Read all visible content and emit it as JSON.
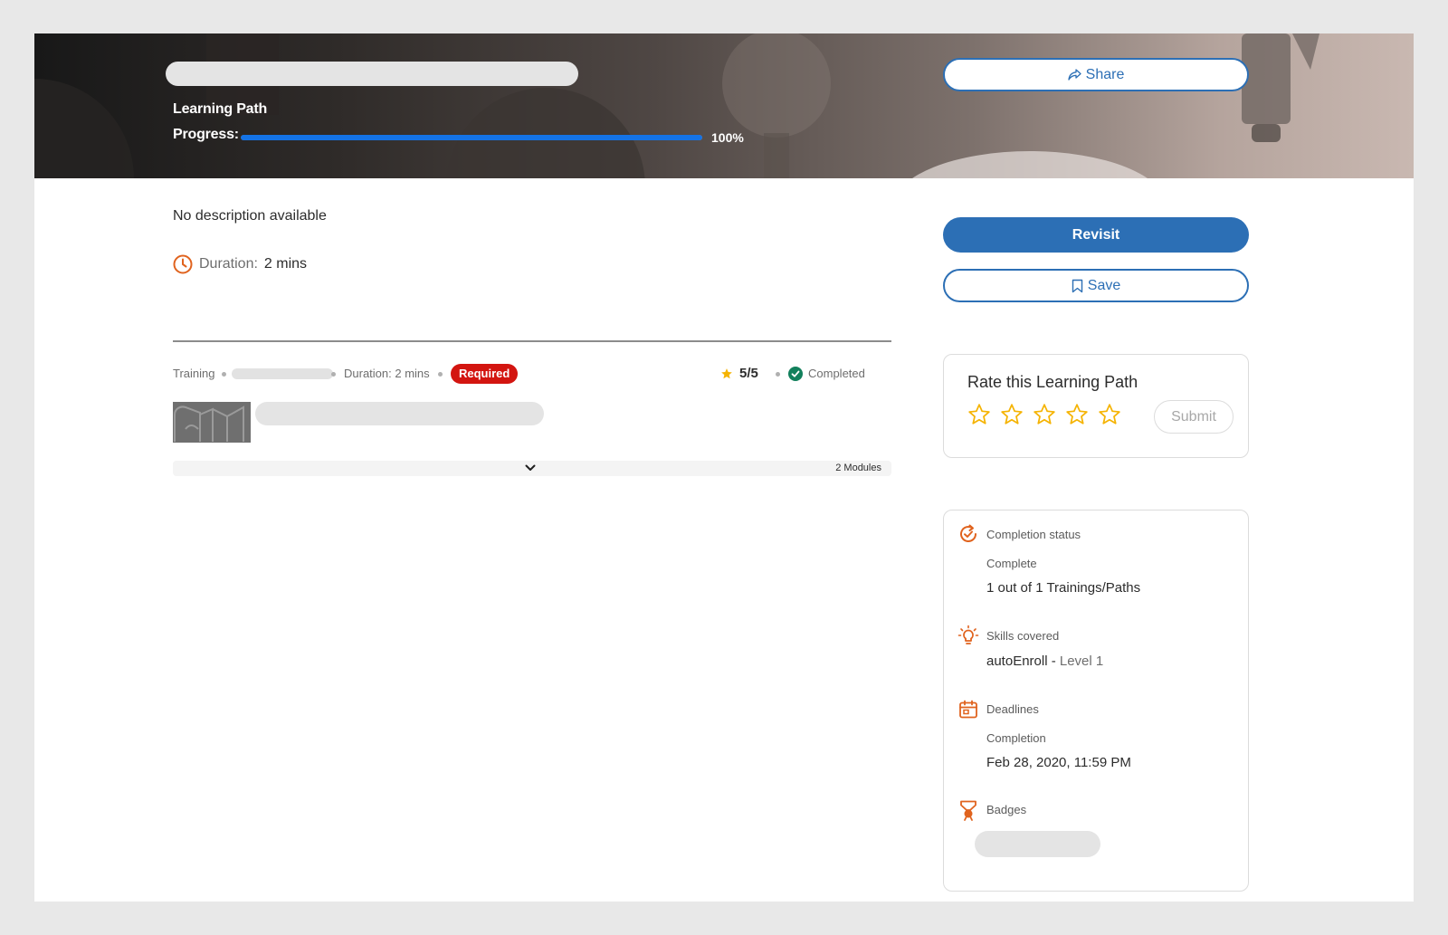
{
  "header": {
    "type_label": "Learning Path",
    "progress_label": "Progress:",
    "progress_value": "100%",
    "progress_fraction": 1.0,
    "share_label": "Share"
  },
  "overview": {
    "description": "No description available",
    "duration_label": "Duration:",
    "duration_value": "2 mins"
  },
  "actions": {
    "revisit_label": "Revisit",
    "save_label": "Save"
  },
  "course_item": {
    "type": "Training",
    "duration": "Duration: 2 mins",
    "required_label": "Required",
    "rating": "5/5",
    "status": "Completed",
    "modules_count": "2 Modules"
  },
  "rating_card": {
    "title": "Rate this Learning Path",
    "stars": 5,
    "submit_label": "Submit"
  },
  "info": {
    "completion_status_label": "Completion status",
    "completion_state": "Complete",
    "completion_detail": "1 out of 1 Trainings/Paths",
    "skills_label": "Skills covered",
    "skill_name": "autoEnroll - ",
    "skill_level": "Level 1",
    "deadlines_label": "Deadlines",
    "deadline_type": "Completion",
    "deadline_value": "Feb 28, 2020, 11:59 PM",
    "badges_label": "Badges"
  },
  "colors": {
    "accent_blue": "#2c6fb5",
    "progress_blue": "#1473e6",
    "required_red": "#d31510",
    "icon_orange": "#e0631e",
    "star_gold": "#f5b301",
    "completed_green": "#12805c"
  },
  "icons": {
    "share": "share-icon",
    "bookmark": "bookmark-icon",
    "clock": "clock-icon",
    "star": "star-icon",
    "check": "check-circle-icon",
    "chevron": "chevron-down-icon",
    "completion": "completion-status-icon",
    "skills": "lightbulb-icon",
    "deadlines": "calendar-icon",
    "badges": "badge-ribbon-icon"
  }
}
